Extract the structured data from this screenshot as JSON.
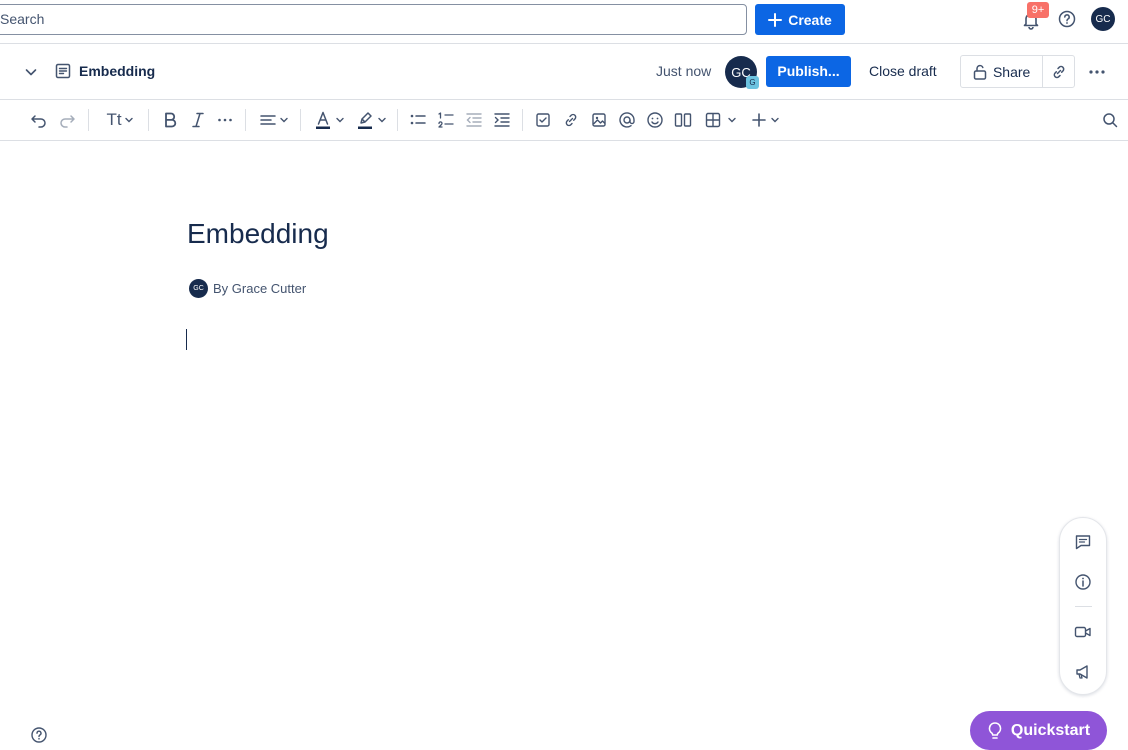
{
  "topbar": {
    "search_placeholder": "Search",
    "create_label": "Create",
    "notification_count": "9+",
    "user_initials": "GC"
  },
  "page_header": {
    "page_title": "Embedding",
    "saved_status": "Just now",
    "collaborator_initials": "GC",
    "collaborator_badge": "G",
    "publish_label": "Publish...",
    "close_draft_label": "Close draft",
    "share_label": "Share"
  },
  "toolbar": {
    "icons": [
      "undo-icon",
      "redo-icon",
      "text-style-icon",
      "bold-icon",
      "italic-icon",
      "more-formatting-icon",
      "align-icon",
      "text-color-icon",
      "highlight-icon",
      "bullet-list-icon",
      "numbered-list-icon",
      "outdent-icon",
      "indent-icon",
      "task-icon",
      "link-icon",
      "image-icon",
      "mention-icon",
      "emoji-icon",
      "layouts-icon",
      "table-icon",
      "insert-icon",
      "find-icon"
    ],
    "text_style_glyph": "Tt",
    "text_color": "#172b4d",
    "highlight_color": "#172b4d"
  },
  "editor": {
    "title": "Embedding",
    "byline": "By Grace Cutter",
    "author_initials": "GC"
  },
  "side_panel": {
    "icons": [
      "comment-icon",
      "info-icon",
      "video-icon",
      "announce-icon"
    ]
  },
  "bottom": {
    "quickstart_label": "Quickstart"
  },
  "colors": {
    "primary_blue": "#0c66e4",
    "avatar_navy": "#172b4d",
    "notification_red": "#f87168",
    "quickstart_purple": "#8f55d8"
  }
}
